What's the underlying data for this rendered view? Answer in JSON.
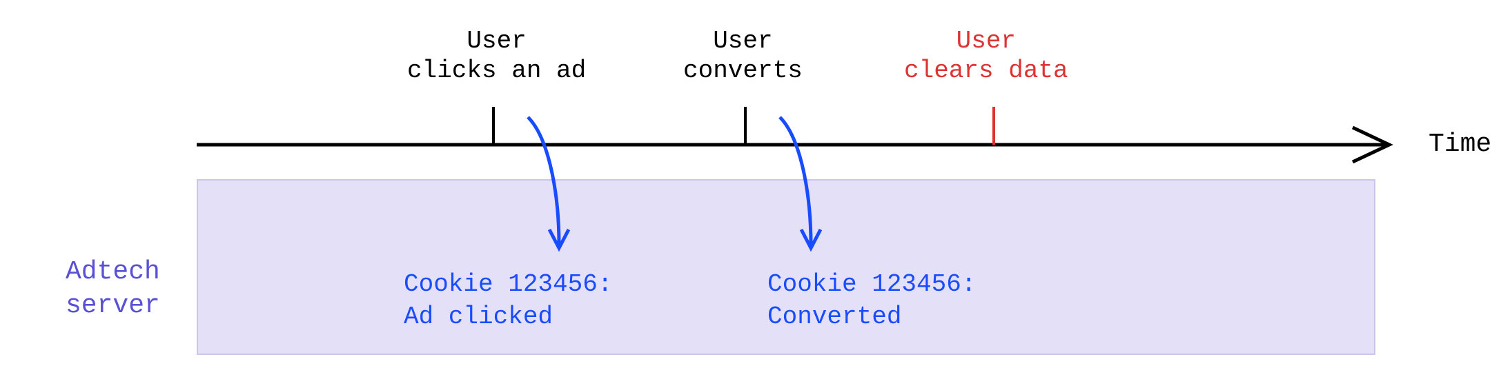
{
  "events": [
    {
      "label": "User\nclicks an ad",
      "color": "black"
    },
    {
      "label": "User\nconverts",
      "color": "black"
    },
    {
      "label": "User\nclears data",
      "color": "red"
    }
  ],
  "axis_label": "Time",
  "server_label": "Adtech\nserver",
  "cookies": [
    {
      "text": "Cookie 123456:\nAd clicked"
    },
    {
      "text": "Cookie 123456:\nConverted"
    }
  ]
}
